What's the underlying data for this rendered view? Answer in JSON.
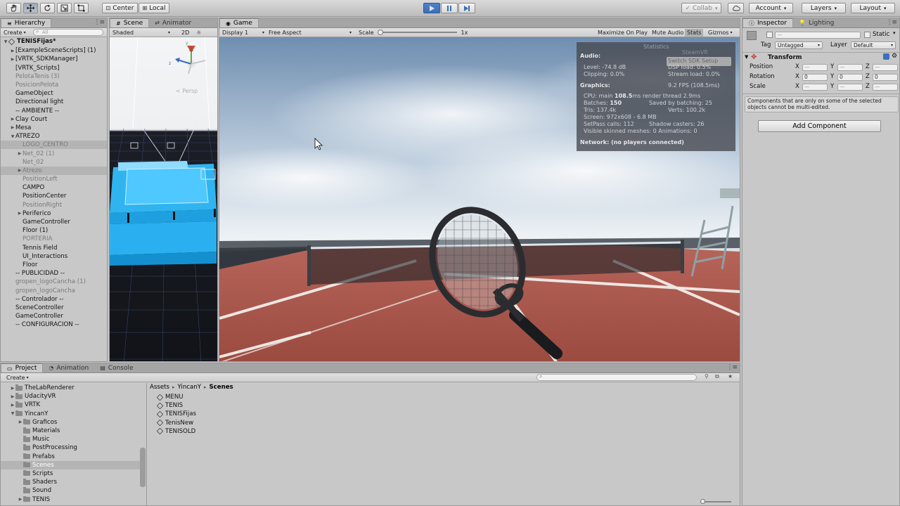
{
  "toolbar": {
    "pivot": "Center",
    "space": "Local",
    "collab": "Collab",
    "account": "Account",
    "layers": "Layers",
    "layout": "Layout"
  },
  "hierarchy": {
    "tab": "Hierarchy",
    "create": "Create",
    "search_placeholder": "All",
    "scene_name": "TENISFijas*",
    "items": [
      {
        "label": "[ExampleSceneScripts] (1)",
        "indent": 1,
        "arrow": "▶",
        "style": ""
      },
      {
        "label": "[VRTK_SDKManager]",
        "indent": 1,
        "arrow": "▶",
        "style": ""
      },
      {
        "label": "[VRTK_Scripts]",
        "indent": 1,
        "arrow": "",
        "style": ""
      },
      {
        "label": "PelotaTenis (3)",
        "indent": 1,
        "arrow": "",
        "style": "dim"
      },
      {
        "label": "PosicionPelota",
        "indent": 1,
        "arrow": "",
        "style": "dim"
      },
      {
        "label": "GameObject",
        "indent": 1,
        "arrow": "",
        "style": ""
      },
      {
        "label": "Directional light",
        "indent": 1,
        "arrow": "",
        "style": ""
      },
      {
        "label": "-- AMBIENTE --",
        "indent": 1,
        "arrow": "",
        "style": ""
      },
      {
        "label": "Clay Court",
        "indent": 1,
        "arrow": "▶",
        "style": ""
      },
      {
        "label": "Mesa",
        "indent": 1,
        "arrow": "▶",
        "style": ""
      },
      {
        "label": "ATREZO",
        "indent": 1,
        "arrow": "▼",
        "style": ""
      },
      {
        "label": "LOGO_CENTRO",
        "indent": 2,
        "arrow": "",
        "style": "dim sel"
      },
      {
        "label": "Net_02 (1)",
        "indent": 2,
        "arrow": "▶",
        "style": "dim"
      },
      {
        "label": "Net_02",
        "indent": 2,
        "arrow": "",
        "style": "dim"
      },
      {
        "label": "Atrezo",
        "indent": 2,
        "arrow": "▶",
        "style": "dim sel"
      },
      {
        "label": "PositionLeft",
        "indent": 2,
        "arrow": "",
        "style": "dim"
      },
      {
        "label": "CAMPO",
        "indent": 2,
        "arrow": "",
        "style": ""
      },
      {
        "label": "PositionCenter",
        "indent": 2,
        "arrow": "",
        "style": ""
      },
      {
        "label": "PositionRight",
        "indent": 2,
        "arrow": "",
        "style": "dim"
      },
      {
        "label": "Periferico",
        "indent": 2,
        "arrow": "▶",
        "style": ""
      },
      {
        "label": "GameController",
        "indent": 2,
        "arrow": "",
        "style": ""
      },
      {
        "label": "Floor (1)",
        "indent": 2,
        "arrow": "",
        "style": ""
      },
      {
        "label": "PORTERIA",
        "indent": 2,
        "arrow": "",
        "style": "dim"
      },
      {
        "label": "Tennis Field",
        "indent": 2,
        "arrow": "",
        "style": ""
      },
      {
        "label": "UI_Interactions",
        "indent": 2,
        "arrow": "",
        "style": ""
      },
      {
        "label": "Floor",
        "indent": 2,
        "arrow": "",
        "style": ""
      },
      {
        "label": "-- PUBLICIDAD --",
        "indent": 1,
        "arrow": "",
        "style": ""
      },
      {
        "label": "gropen_logoCancha (1)",
        "indent": 1,
        "arrow": "",
        "style": "dim"
      },
      {
        "label": "gropen_logoCancha",
        "indent": 1,
        "arrow": "",
        "style": "dim"
      },
      {
        "label": "-- Controlador --",
        "indent": 1,
        "arrow": "",
        "style": ""
      },
      {
        "label": "SceneController",
        "indent": 1,
        "arrow": "",
        "style": ""
      },
      {
        "label": "GameController",
        "indent": 1,
        "arrow": "",
        "style": ""
      },
      {
        "label": "-- CONFIGURACION --",
        "indent": 1,
        "arrow": "",
        "style": ""
      }
    ]
  },
  "scene": {
    "tab": "Scene",
    "tab2": "Animator",
    "shading": "Shaded",
    "mode2d": "2D",
    "persp": "< Persp"
  },
  "game": {
    "tab": "Game",
    "display": "Display 1",
    "aspect": "Free Aspect",
    "scale_label": "Scale",
    "scale_value": "1x",
    "maximize": "Maximize On Play",
    "mute": "Mute Audio",
    "stats": "Stats",
    "gizmos": "Gizmos"
  },
  "stats": {
    "title": "Statistics",
    "steamvr": "SteamVR",
    "switch_sdk": "Switch SDK Setup",
    "audio_header": "Audio:",
    "level": "Level: -74.8 dB",
    "dsp": "DSP load: 0.5%",
    "clipping": "Clipping: 0.0%",
    "stream": "Stream load: 0.0%",
    "graphics_header": "Graphics:",
    "fps": "9.2 FPS (108.5ms)",
    "cpu_prefix": "CPU: main ",
    "cpu_main": "108.5",
    "cpu_suffix": "ms  render thread 2.9ms",
    "batches_prefix": "Batches: ",
    "batches_value": "150",
    "saved": "Saved by batching: 25",
    "tris": "Tris: 137.4k",
    "verts": "Verts: 100.2k",
    "screen": "Screen: 972x608 - 6.8 MB",
    "setpass": "SetPass calls: 112",
    "shadow": "Shadow casters: 26",
    "skinned": "Visible skinned meshes: 0  Animations: 0",
    "network": "Network: (no players connected)"
  },
  "inspector": {
    "tab": "Inspector",
    "tab2": "Lighting",
    "static_label": "Static",
    "tag_label": "Tag",
    "tag_value": "Untagged",
    "layer_label": "Layer",
    "layer_value": "Default",
    "transform_title": "Transform",
    "position": "Position",
    "rotation": "Rotation",
    "scale": "Scale",
    "x": "X",
    "y": "Y",
    "z": "Z",
    "dash": "—",
    "zero": "0",
    "note": "Components that are only on some of the selected objects cannot be multi-edited.",
    "add_component": "Add Component"
  },
  "project": {
    "tab": "Project",
    "tab2": "Animation",
    "tab3": "Console",
    "create": "Create",
    "breadcrumb": [
      "Assets",
      "YincanY",
      "Scenes"
    ],
    "tree": [
      {
        "label": "TheLabRenderer",
        "indent": 1,
        "arrow": "▶",
        "sel": false
      },
      {
        "label": "UdacityVR",
        "indent": 1,
        "arrow": "▶",
        "sel": false
      },
      {
        "label": "VRTK",
        "indent": 1,
        "arrow": "▶",
        "sel": false
      },
      {
        "label": "YincanY",
        "indent": 1,
        "arrow": "▼",
        "sel": false
      },
      {
        "label": "Graficos",
        "indent": 2,
        "arrow": "▶",
        "sel": false
      },
      {
        "label": "Materials",
        "indent": 2,
        "arrow": "",
        "sel": false
      },
      {
        "label": "Music",
        "indent": 2,
        "arrow": "",
        "sel": false
      },
      {
        "label": "PostProcessing",
        "indent": 2,
        "arrow": "",
        "sel": false
      },
      {
        "label": "Prefabs",
        "indent": 2,
        "arrow": "",
        "sel": false
      },
      {
        "label": "Scenes",
        "indent": 2,
        "arrow": "",
        "sel": true
      },
      {
        "label": "Scripts",
        "indent": 2,
        "arrow": "",
        "sel": false
      },
      {
        "label": "Shaders",
        "indent": 2,
        "arrow": "",
        "sel": false
      },
      {
        "label": "Sound",
        "indent": 2,
        "arrow": "",
        "sel": false
      },
      {
        "label": "TENIS",
        "indent": 2,
        "arrow": "▶",
        "sel": false
      }
    ],
    "scenes": [
      "MENU",
      "TENIS",
      "TENISFijas",
      "TenisNew",
      "TENISOLD"
    ]
  }
}
